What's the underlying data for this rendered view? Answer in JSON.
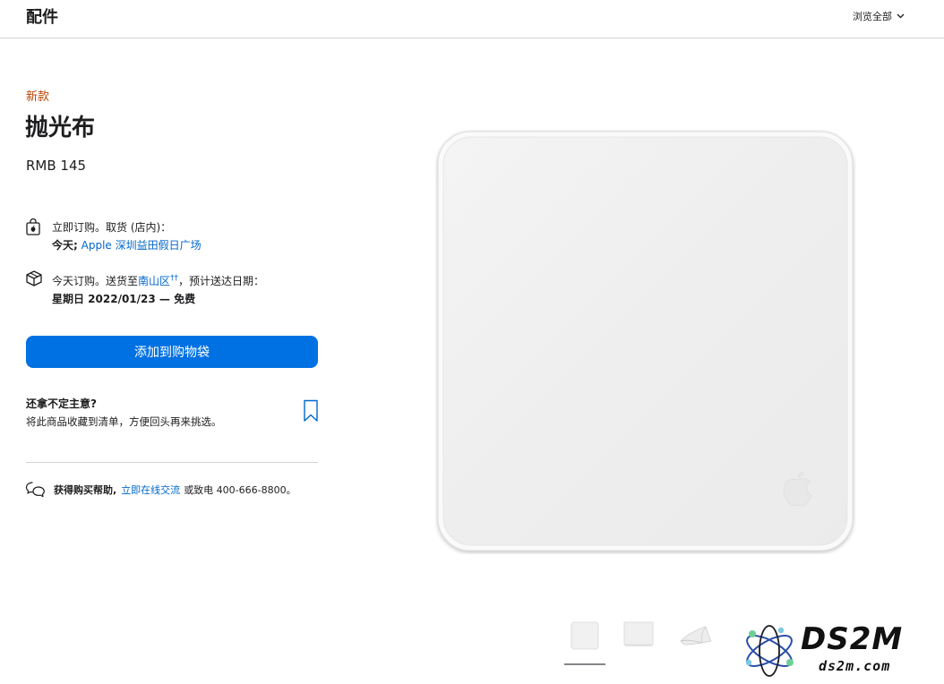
{
  "header": {
    "title": "配件",
    "browse_label": "浏览全部"
  },
  "product": {
    "badge": "新款",
    "name": "抛光布",
    "price": "RMB 145"
  },
  "pickup": {
    "line1": "立即订购。取货 (店内)：",
    "today": "今天;",
    "store_link": "Apple 深圳益田假日广场"
  },
  "delivery": {
    "prefix": "今天订购。送货至",
    "location_link": "南山区",
    "location_mark": "††",
    "suffix": "，预计送达日期：",
    "date_line": "星期日 2022/01/23 — 免费"
  },
  "actions": {
    "add_to_bag": "添加到购物袋"
  },
  "save_for_later": {
    "title": "还拿不定主意?",
    "subtitle": "将此商品收藏到清单，方便回头再来挑选。"
  },
  "help": {
    "label": "获得购买帮助,",
    "chat_link": "立即在线交流",
    "phone_text": "或致电 400-666-8800。"
  },
  "watermark": {
    "main": "DS2M",
    "sub": "ds2m.com"
  },
  "colors": {
    "accent": "#0071e3",
    "link": "#0066cc",
    "badge": "#b64400"
  }
}
